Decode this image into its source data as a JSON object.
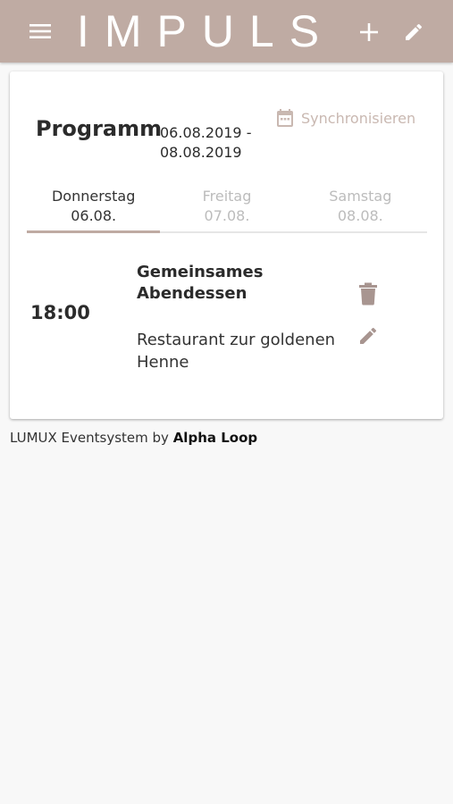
{
  "header": {
    "brand": "IMPULS",
    "background_color": "#bfaba3",
    "icons": [
      "menu-icon",
      "plus-icon",
      "pencil-icon"
    ]
  },
  "program": {
    "title": "Programm",
    "date_range": "06.08.2019 - 08.08.2019",
    "sync_label": "Synchronisieren",
    "sync_icon": "calendar-icon"
  },
  "tabs": [
    {
      "day": "Donnerstag",
      "date": "06.08.",
      "active": true
    },
    {
      "day": "Freitag",
      "date": "07.08.",
      "active": false
    },
    {
      "day": "Samstag",
      "date": "08.08.",
      "active": false
    }
  ],
  "events": [
    {
      "time": "18:00",
      "title": "Gemeinsames Abendessen",
      "location": "Restaurant zur goldenen Henne",
      "icons": [
        "trash-icon",
        "pencil-icon"
      ]
    }
  ],
  "footer": {
    "prefix": "LUMUX Eventsystem by",
    "link": "Alpha Loop"
  },
  "colors": {
    "accent": "#bfaba3",
    "muted_icon": "#a89590",
    "sync_text": "#c9b8b1"
  }
}
